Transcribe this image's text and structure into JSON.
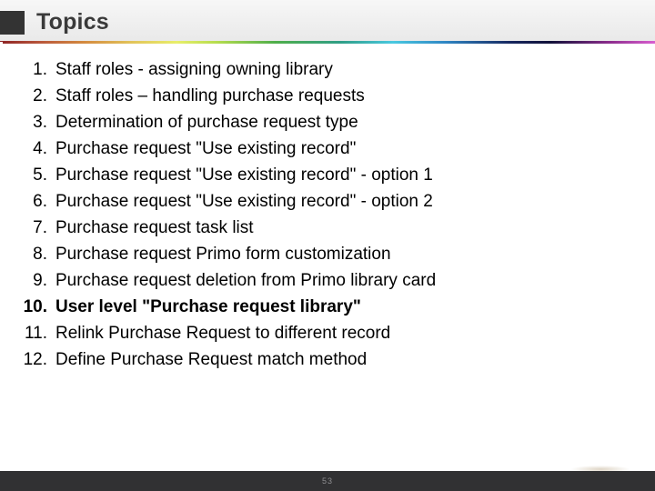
{
  "slide": {
    "header": {
      "title": "Topics",
      "marker_icon": "square-bullet-icon",
      "marker_color": "#333333",
      "band_color": "#efefef",
      "rule_icon": "rainbow-rule-divider"
    },
    "topics": [
      {
        "number": "1.",
        "text": "Staff roles - assigning owning library",
        "bold": false
      },
      {
        "number": "2.",
        "text": "Staff roles – handling purchase requests",
        "bold": false
      },
      {
        "number": "3.",
        "text": "Determination of purchase request type",
        "bold": false
      },
      {
        "number": "4.",
        "text": "Purchase request \"Use existing record\"",
        "bold": false
      },
      {
        "number": "5.",
        "text": "Purchase request \"Use existing record\" - option 1",
        "bold": false
      },
      {
        "number": "6.",
        "text": "Purchase request \"Use existing record\" - option 2",
        "bold": false
      },
      {
        "number": "7.",
        "text": "Purchase request task list",
        "bold": false
      },
      {
        "number": "8.",
        "text": "Purchase request Primo form customization",
        "bold": false
      },
      {
        "number": "9.",
        "text": "Purchase request deletion from Primo library card",
        "bold": false
      },
      {
        "number": "10.",
        "text": "User level \"Purchase request library\"",
        "bold": true
      },
      {
        "number": "11.",
        "text": "Relink Purchase Request to different record",
        "bold": false
      },
      {
        "number": "12.",
        "text": "Define Purchase Request match method",
        "bold": false
      }
    ],
    "footer": {
      "page_number": "53",
      "bar_color": "#313133",
      "page_number_color": "#8d8d90"
    }
  }
}
